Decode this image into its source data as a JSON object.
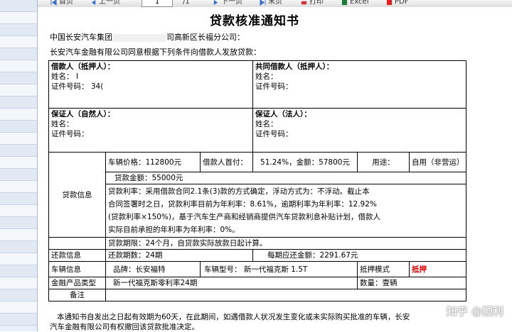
{
  "toolbar": {
    "first_label": "首页",
    "prev_label": "上一页",
    "page_value": "1",
    "page_total": "/1",
    "next_label": "下一页",
    "last_label": "末页",
    "print_label": "打印",
    "excel_label": "Excel",
    "pdf_label": "PDF"
  },
  "doc": {
    "title": "贷款核准通知书",
    "addressee_a": "中国长安汽车集团",
    "addressee_b": "司高新区长福分公司：",
    "intro": "长安汽车金融有限公司同意根据下列条件向借款人发放贷款：",
    "borrower_header": "借款人（抵押人）：",
    "co_borrower_header": "共同借款人（抵押人）：",
    "name_label": "姓名：",
    "borrower_name_partial": "Ⅰ",
    "id_label": "证件号码：",
    "borrower_id_partial": "34(",
    "guarantor_person_header": "保证人（自然人）：",
    "guarantor_corp_header": "保证人（法人）：",
    "vehicle_price_label": "车辆价格：",
    "vehicle_price": "112800元",
    "down_payment_label": "借款人首付：",
    "down_payment": "51.24%，金额：57800元",
    "usage_label": "用途：",
    "usage_value": "自用（非营运）",
    "loan_amount": "贷款金额：55000元",
    "loan_info_label": "贷款信息",
    "rate_line1": "贷款利率：采用借款合同2.1条(3)款的方式确定，浮动方式为：不浮动。截止本",
    "rate_line2": "合同签署时之日，贷款利率目前为年利率：8.61%，逾期利率为年利率：12.92%",
    "rate_line3": "(贷款利率×150%)，基于汽车生产商和经销商提供汽车贷款利息补贴计划，借款人",
    "rate_line4": "实际目前承担的年利率为年利率：0%。",
    "term": "贷款期限：24个月，自贷款实际放款日起计算。",
    "repay_label": "还款信息",
    "repay_periods": "还款期数：24期",
    "monthly_payment": "每期应还金额：2291.67元",
    "vehicle_info_label": "车辆信息",
    "brand": "品牌：长安福特",
    "model": "车辆型号：  新一代福克斯 1.5T",
    "mortgage_mode_label": "抵押模式",
    "mortgage_mode_value": "抵押",
    "product_type_label": "金融产品类型",
    "product_type_value": "新一代福克斯零利率24期",
    "quantity": "数量：壹辆",
    "remarks_label": "备注",
    "footer_line1": "本通知书自发出之日起有效期为60天，在此期间，如遇借款人状况发生变化或未实际购买批准的车辆，长安",
    "footer_line2": "汽车金融有限公司有权撤回该贷款批准决定。",
    "watermark": "知乎 @顺利"
  }
}
